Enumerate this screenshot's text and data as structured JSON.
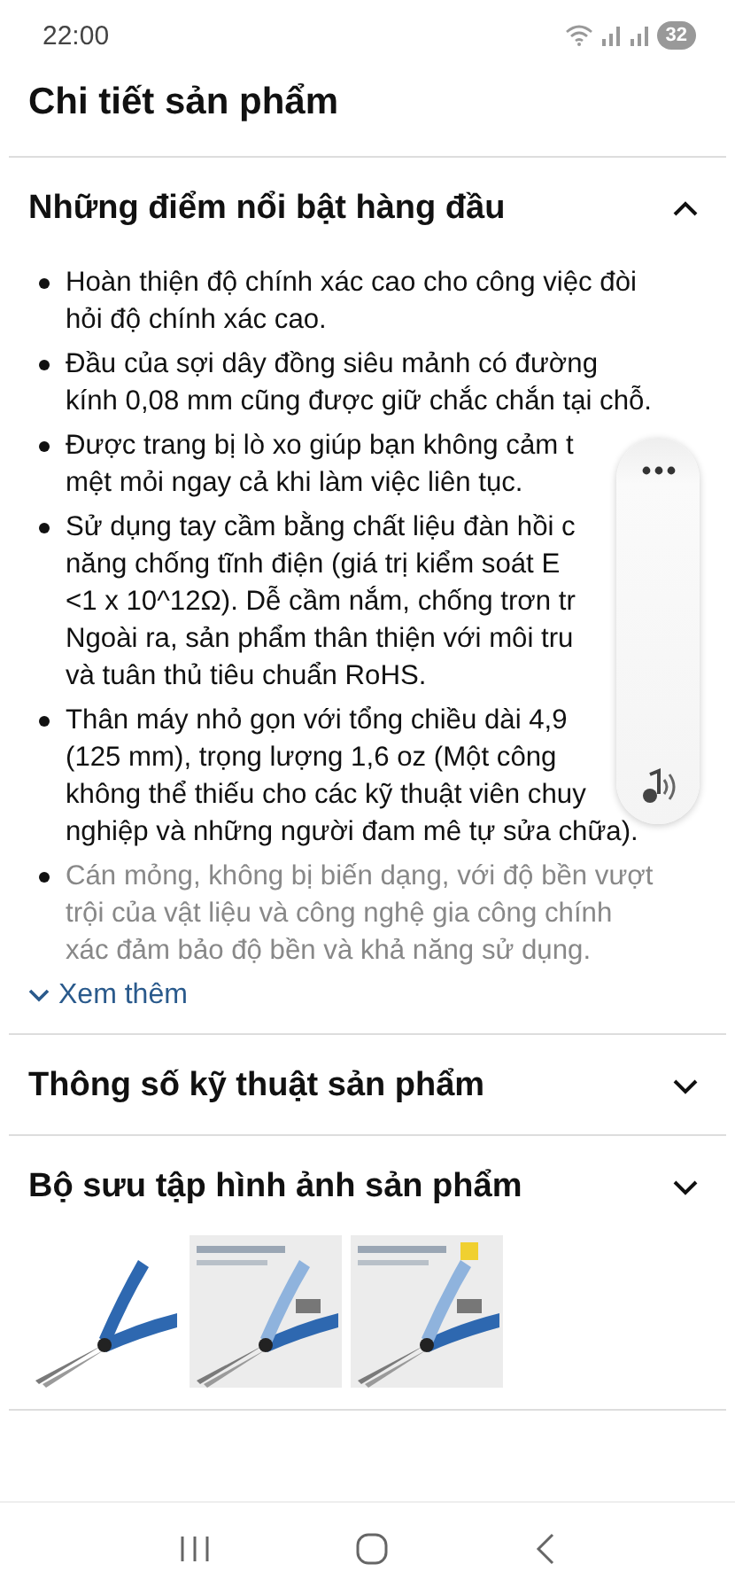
{
  "status_bar": {
    "time": "22:00",
    "battery": "32"
  },
  "title": "Chi tiết sản phẩm",
  "sections": [
    {
      "title": "Những điểm nổi bật hàng đầu",
      "expanded": true,
      "bullets": [
        {
          "lines": [
            "Hoàn thiện độ chính xác cao cho công việc đòi",
            "hỏi độ chính xác cao."
          ],
          "faded": false
        },
        {
          "lines": [
            "Đầu của sợi dây đồng siêu mảnh có đường",
            "kính 0,08 mm cũng được giữ chắc chắn tại chỗ."
          ],
          "faded": false
        },
        {
          "lines": [
            "Được trang bị lò xo giúp bạn không cảm t",
            "mệt mỏi ngay cả khi làm việc liên tục."
          ],
          "faded": false
        },
        {
          "lines": [
            "Sử dụng tay cầm bằng chất liệu đàn hồi c",
            "năng chống tĩnh điện (giá trị kiểm soát E",
            "<1 x 10^12Ω). Dễ cầm nắm, chống trơn tr",
            "Ngoài ra, sản phẩm thân thiện với môi tru",
            "và tuân thủ tiêu chuẩn RoHS."
          ],
          "faded": false
        },
        {
          "lines": [
            "Thân máy nhỏ gọn với tổng chiều dài 4,9",
            "(125 mm), trọng lượng 1,6 oz (Một công",
            "không thể thiếu cho các kỹ thuật viên chuy",
            "nghiệp và những người đam mê tự sửa chữa)."
          ],
          "faded": false
        },
        {
          "lines": [
            "Cán mỏng, không bị biến dạng, với độ bền vượt",
            "trội của vật liệu và công nghệ gia công chính",
            "xác đảm bảo độ bền và khả năng sử dụng."
          ],
          "faded": true
        }
      ],
      "more_link": "Xem thêm"
    },
    {
      "title": "Thông số kỹ thuật sản phẩm",
      "expanded": false
    },
    {
      "title": "Bộ sưu tập hình ảnh sản phẩm",
      "expanded": false
    }
  ]
}
